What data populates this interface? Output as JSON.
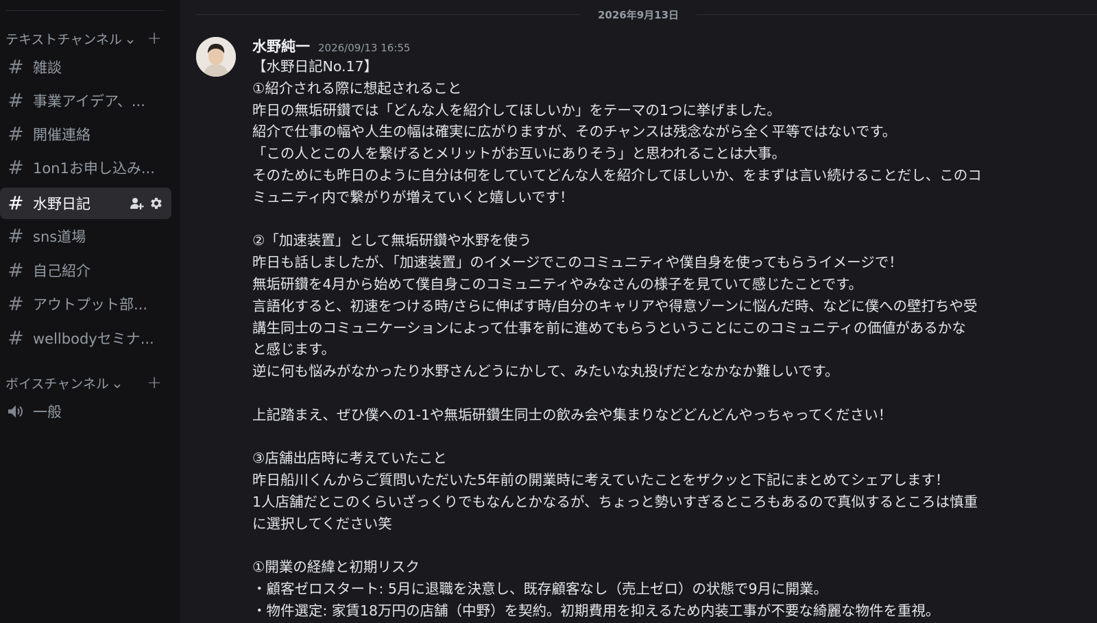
{
  "sidebar": {
    "text_category": {
      "label": "テキストチャンネル",
      "icon": "chevron-down-icon",
      "add_icon": "plus-icon"
    },
    "channels": [
      {
        "label": "雑談",
        "icon": "hash-icon"
      },
      {
        "label": "事業アイデア、...",
        "icon": "hash-icon"
      },
      {
        "label": "開催連絡",
        "icon": "hash-icon"
      },
      {
        "label": "1on1お申し込み...",
        "icon": "hash-icon"
      },
      {
        "label": "水野日記",
        "icon": "hash-icon",
        "active": true
      },
      {
        "label": "sns道場",
        "icon": "hash-icon"
      },
      {
        "label": "自己紹介",
        "icon": "hash-icon"
      },
      {
        "label": "アウトプット部...",
        "icon": "hash-icon"
      },
      {
        "label": "wellbodyセミナ...",
        "icon": "hash-icon"
      }
    ],
    "active_channel_actions": [
      "add-member-icon",
      "gear-icon"
    ],
    "voice_category": {
      "label": "ボイスチャンネル",
      "icon": "chevron-down-icon",
      "add_icon": "plus-icon"
    },
    "voice_channels": [
      {
        "label": "一般",
        "icon": "speaker-icon"
      }
    ]
  },
  "main": {
    "date_divider": "2026年9月13日",
    "message": {
      "author": "水野純一",
      "timestamp": "2026/09/13 16:55",
      "lines": [
        "【水野日記No.17】",
        "①紹介される際に想起されること",
        "昨日の無垢研鑽では「どんな人を紹介してほしいか」をテーマの1つに挙げました。",
        "紹介で仕事の幅や人生の幅は確実に広がりますが、そのチャンスは残念ながら全く平等ではないです。",
        "「この人とこの人を繋げるとメリットがお互いにありそう」と思われることは大事。",
        "そのためにも昨日のように自分は何をしていてどんな人を紹介してほしいか、をまずは言い続けることだし、このコ",
        "ミュニティ内で繋がりが増えていくと嬉しいです！",
        "",
        "②「加速装置」として無垢研鑽や水野を使う",
        "昨日も話しましたが、「加速装置」のイメージでこのコミュニティや僕自身を使ってもらうイメージで！",
        "無垢研鑽を4月から始めて僕自身このコミュニティやみなさんの様子を見ていて感じたことです。",
        "言語化すると、初速をつける時/さらに伸ばす時/自分のキャリアや得意ゾーンに悩んだ時、などに僕への壁打ちや受",
        "講生同士のコミュニケーションによって仕事を前に進めてもらうということにこのコミュニティの価値があるかな",
        "と感じます。",
        "逆に何も悩みがなかったり水野さんどうにかして、みたいな丸投げだとなかなか難しいです。",
        "",
        "上記踏まえ、ぜひ僕への1-1や無垢研鑽生同士の飲み会や集まりなどどんどんやっちゃってください！",
        "",
        "③店舗出店時に考えていたこと",
        "昨日船川くんからご質問いただいた5年前の開業時に考えていたことをザクッと下記にまとめてシェアします！",
        "1人店舗だとこのくらいざっくりでもなんとかなるが、ちょっと勢いすぎるところもあるので真似するところは慎重",
        "に選択してください笑",
        "",
        "①開業の経緯と初期リスク",
        "・顧客ゼロスタート: 5月に退職を決意し、既存顧客なし（売上ゼロ）の状態で9月に開業。",
        "・物件選定: 家賃18万円の店舗（中野）を契約。初期費用を抑えるため内装工事が不要な綺麗な物件を重視。"
      ]
    }
  },
  "colors": {
    "sidebar_bg": "#121214",
    "main_bg": "#1a1a1e",
    "active_channel_bg": "#2b2b30",
    "text_primary": "#e3e5e8",
    "text_muted": "#949ba4"
  }
}
